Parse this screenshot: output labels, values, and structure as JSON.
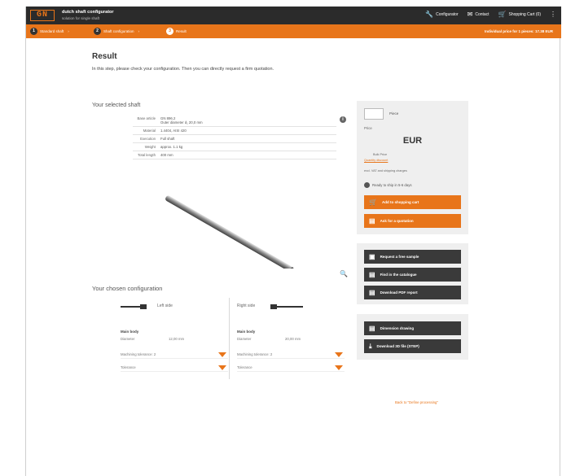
{
  "header": {
    "logo": "GN",
    "title": "dutch shaft configurator",
    "subtitle": "solution for single shaft",
    "nav": [
      {
        "icon": "wrench-icon",
        "label": "Configurator"
      },
      {
        "icon": "mail-icon",
        "label": "Contact"
      },
      {
        "icon": "cart-icon",
        "label": "Shopping Cart (0)"
      }
    ],
    "more": "⋮"
  },
  "steps": [
    {
      "num": "1",
      "label": "Standard shaft"
    },
    {
      "num": "2",
      "label": "Shaft configuration"
    },
    {
      "num": "3",
      "label": "Result"
    }
  ],
  "price_note": "Individual price for 1 pieces: 17.38 EUR",
  "main": {
    "title": "Result",
    "intro": "In this step, please check your configuration. Then you can directly request a firm quotation.",
    "shaft_heading": "Your selected shaft",
    "specs": [
      {
        "k": "Base article",
        "v": "GN 896.2",
        "v2": "Outer diameter d₁ 20,0 mm"
      },
      {
        "k": "Material",
        "v": "1.4404, AISI 420"
      },
      {
        "k": "Execution",
        "v": "Full shaft"
      },
      {
        "k": "Weight",
        "v": "approx. 1.1 kg"
      },
      {
        "k": "Total length",
        "v": "400 mm"
      }
    ],
    "config_heading": "Your chosen configuration",
    "left": {
      "label": "Left side",
      "body_title": "Main body",
      "diam_k": "Diameter",
      "diam_v": "12,00 mm",
      "opt1": "Machining tolerance: 2",
      "opt2": "Tolerance"
    },
    "right": {
      "label": "Right side",
      "body_title": "Main body",
      "diam_k": "Diameter",
      "diam_v": "20,00 mm",
      "opt1": "Machining tolerance: 2",
      "opt2": "Tolerance"
    },
    "back_link": "Back to \"Define processing\""
  },
  "order": {
    "qty_label": "Piece",
    "price_label": "Price",
    "currency": "EUR",
    "meta1": "Bulk Price",
    "meta2": "Quantity discount",
    "meta3": "excl. VAT and shipping charges",
    "shipping": "Ready to ship in 5-6 days",
    "add_cart": "Add to shopping cart",
    "quotation": "Ask for a quotation"
  },
  "actions": {
    "sample": "Request a free sample",
    "catalogue": "Find in the catalogue",
    "pdf": "Download PDF report"
  },
  "downloads": {
    "drawing": "Dimension drawing",
    "cad": "Download 3D file (STEP)"
  },
  "colors": {
    "accent": "#e8751a",
    "dark": "#2b2b2b"
  }
}
